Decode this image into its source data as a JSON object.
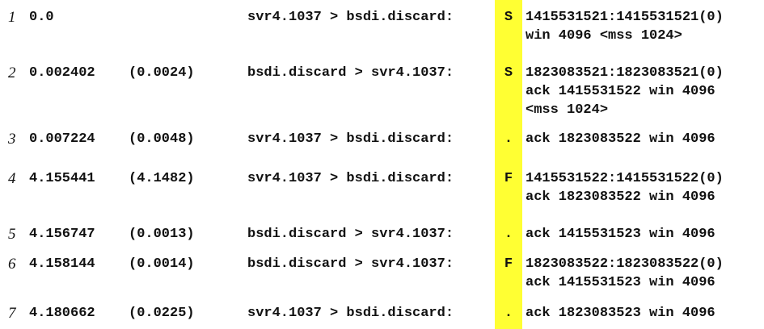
{
  "colors": {
    "highlight": "#ffff33",
    "text": "#111111"
  },
  "packets": [
    {
      "num": "1",
      "time": "0.0",
      "delta": "",
      "conn": "svr4.1037 > bsdi.discard:",
      "flag": "S",
      "info": "1415531521:1415531521(0)\nwin 4096 <mss 1024>"
    },
    {
      "num": "2",
      "time": "0.002402",
      "delta": "(0.0024)",
      "conn": "bsdi.discard > svr4.1037:",
      "flag": "S",
      "info": "1823083521:1823083521(0)\nack 1415531522 win 4096\n<mss 1024>"
    },
    {
      "num": "3",
      "time": "0.007224",
      "delta": "(0.0048)",
      "conn": "svr4.1037 > bsdi.discard:",
      "flag": ".",
      "info": "ack 1823083522 win 4096"
    },
    {
      "num": "4",
      "time": "4.155441",
      "delta": "(4.1482)",
      "conn": "svr4.1037 > bsdi.discard:",
      "flag": "F",
      "info": "1415531522:1415531522(0)\nack 1823083522 win 4096"
    },
    {
      "num": "5",
      "time": "4.156747",
      "delta": "(0.0013)",
      "conn": "bsdi.discard > svr4.1037:",
      "flag": ".",
      "info": "ack 1415531523 win 4096"
    },
    {
      "num": "6",
      "time": "4.158144",
      "delta": "(0.0014)",
      "conn": "bsdi.discard > svr4.1037:",
      "flag": "F",
      "info": "1823083522:1823083522(0)\nack 1415531523 win 4096"
    },
    {
      "num": "7",
      "time": "4.180662",
      "delta": "(0.0225)",
      "conn": "svr4.1037 > bsdi.discard:",
      "flag": ".",
      "info": "ack 1823083523 win 4096"
    }
  ]
}
